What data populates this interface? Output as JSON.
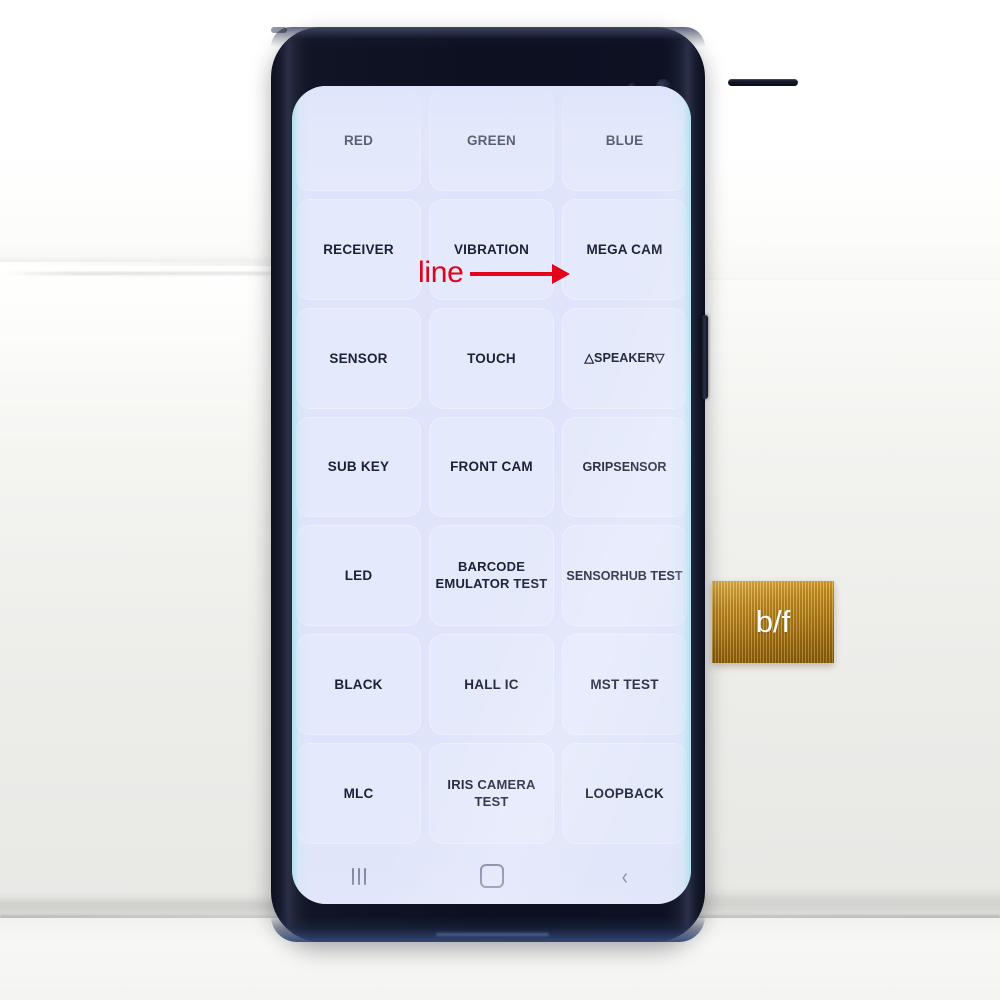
{
  "scene": {
    "title": "Samsung hardware diagnostic test menu on phone screen",
    "device": "smartphone with curved edge display",
    "background_description": "white foam block on white table"
  },
  "phone": {
    "earpiece_name": "earpiece-speaker",
    "front_camera_name": "front-camera",
    "power_button_name": "power-button",
    "volume_button_name": "volume-button"
  },
  "screen": {
    "background_color": "#dfe4fa",
    "text_color": "#1d2138",
    "edge_glow_color": "#a8e0ee",
    "grid": {
      "columns": 3,
      "rows": 7,
      "buttons": [
        {
          "label": "RED",
          "name": "test-button-red"
        },
        {
          "label": "GREEN",
          "name": "test-button-green"
        },
        {
          "label": "BLUE",
          "name": "test-button-blue"
        },
        {
          "label": "RECEIVER",
          "name": "test-button-receiver"
        },
        {
          "label": "VIBRATION",
          "name": "test-button-vibration"
        },
        {
          "label": "MEGA CAM",
          "name": "test-button-mega-cam"
        },
        {
          "label": "SENSOR",
          "name": "test-button-sensor"
        },
        {
          "label": "TOUCH",
          "name": "test-button-touch"
        },
        {
          "label": "△SPEAKER▽",
          "name": "test-button-speaker"
        },
        {
          "label": "SUB KEY",
          "name": "test-button-sub-key"
        },
        {
          "label": "FRONT CAM",
          "name": "test-button-front-cam"
        },
        {
          "label": "GRIPSENSOR",
          "name": "test-button-gripsensor"
        },
        {
          "label": "LED",
          "name": "test-button-led"
        },
        {
          "label": "BARCODE\nEMULATOR TEST",
          "name": "test-button-barcode-emulator-test"
        },
        {
          "label": "SENSORHUB TEST",
          "name": "test-button-sensorhub-test"
        },
        {
          "label": "BLACK",
          "name": "test-button-black"
        },
        {
          "label": "HALL IC",
          "name": "test-button-hall-ic"
        },
        {
          "label": "MST TEST",
          "name": "test-button-mst-test"
        },
        {
          "label": "MLC",
          "name": "test-button-mlc"
        },
        {
          "label": "IRIS CAMERA\nTEST",
          "name": "test-button-iris-camera-test"
        },
        {
          "label": "LOOPBACK",
          "name": "test-button-loopback"
        }
      ]
    },
    "navbar": {
      "recents_label": "recents",
      "home_label": "home",
      "back_label": "‹",
      "icon_color": "#53577a"
    }
  },
  "annotations": {
    "line": {
      "text": "line",
      "color": "#e3021a",
      "points_to": "vertical display line defect near MEGA CAM column"
    },
    "flex_cable": {
      "text": "b/f",
      "text_color": "#ffffff",
      "cable_color": "#b9810f"
    }
  }
}
